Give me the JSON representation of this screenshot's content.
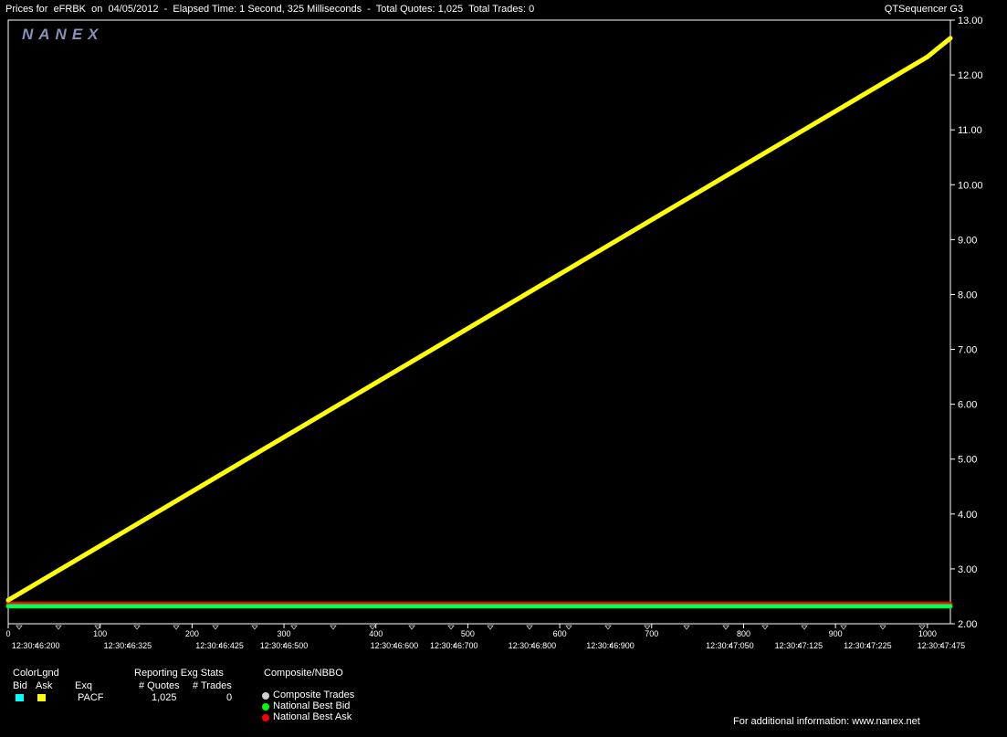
{
  "header": {
    "title": "Prices for  eFRBK  on  04/05/2012  -  Elapsed Time: 1 Second, 325 Milliseconds  -  Total Quotes: 1,025  Total Trades: 0",
    "app_name": "QTSequencer G3",
    "logo_text": "NANEX"
  },
  "chart_data": {
    "type": "line",
    "title": "",
    "xlim": [
      0,
      1025
    ],
    "ylim": [
      2.0,
      13.0
    ],
    "y_ticks": [
      "2.00",
      "3.00",
      "4.00",
      "5.00",
      "6.00",
      "7.00",
      "8.00",
      "9.00",
      "10.00",
      "11.00",
      "12.00",
      "13.00"
    ],
    "x_ticks": [
      "0",
      "100",
      "200",
      "300",
      "400",
      "500",
      "600",
      "700",
      "800",
      "900",
      "1000"
    ],
    "time_labels": [
      {
        "x": 30,
        "label": "12:30:46:200"
      },
      {
        "x": 130,
        "label": "12:30:46:325"
      },
      {
        "x": 230,
        "label": "12:30:46:425"
      },
      {
        "x": 300,
        "label": "12:30:46:500"
      },
      {
        "x": 420,
        "label": "12:30:46:600"
      },
      {
        "x": 485,
        "label": "12:30:46:700"
      },
      {
        "x": 570,
        "label": "12:30:46:800"
      },
      {
        "x": 655,
        "label": "12:30:46:900"
      },
      {
        "x": 785,
        "label": "12:30:47:050"
      },
      {
        "x": 860,
        "label": "12:30:47:125"
      },
      {
        "x": 935,
        "label": "12:30:47:225"
      },
      {
        "x": 1015,
        "label": "12:30:47:475"
      }
    ],
    "grid": true,
    "series": [
      {
        "name": "National Best Ask",
        "color": "#FF0000",
        "x": [
          0,
          1025
        ],
        "y": [
          2.36,
          2.36
        ]
      },
      {
        "name": "National Best Bid",
        "color": "#00FF00",
        "x": [
          0,
          1025
        ],
        "y": [
          2.32,
          2.32
        ]
      },
      {
        "name": "Ask",
        "color": "#FFFF00",
        "x": [
          0,
          100,
          200,
          300,
          400,
          500,
          600,
          700,
          800,
          900,
          1000,
          1025
        ],
        "y": [
          2.43,
          3.42,
          4.41,
          5.4,
          6.39,
          7.38,
          8.37,
          9.36,
          10.35,
          11.34,
          12.33,
          12.67
        ]
      },
      {
        "name": "Bid",
        "color": "#00FFFF",
        "x": [
          0,
          1025
        ],
        "y": [
          2.32,
          2.32
        ]
      }
    ],
    "colors": {
      "background": "#000000",
      "grid": "#FFFFFF",
      "axis_text": "#FFFFFF"
    }
  },
  "legend": {
    "color_legend_label": "ColorLgnd",
    "bid_label": "Bid",
    "ask_label": "Ask",
    "exch_label": "Exq",
    "bid_color": "#00FFFF",
    "ask_color": "#FFFF00",
    "reporting_label": "Reporting Exg Stats",
    "quotes_label": "# Quotes",
    "trades_label": "# Trades",
    "rows": [
      {
        "exch": "PACF",
        "quotes": "1,025",
        "trades": "0"
      }
    ],
    "composite_label": "Composite/NBBO",
    "composite_items": [
      {
        "label": "Composite Trades",
        "color": "#D0D0D0"
      },
      {
        "label": "National Best Bid",
        "color": "#00FF00"
      },
      {
        "label": "National Best Ask",
        "color": "#FF0000"
      }
    ],
    "footer_text": "For additional information: www.nanex.net"
  }
}
